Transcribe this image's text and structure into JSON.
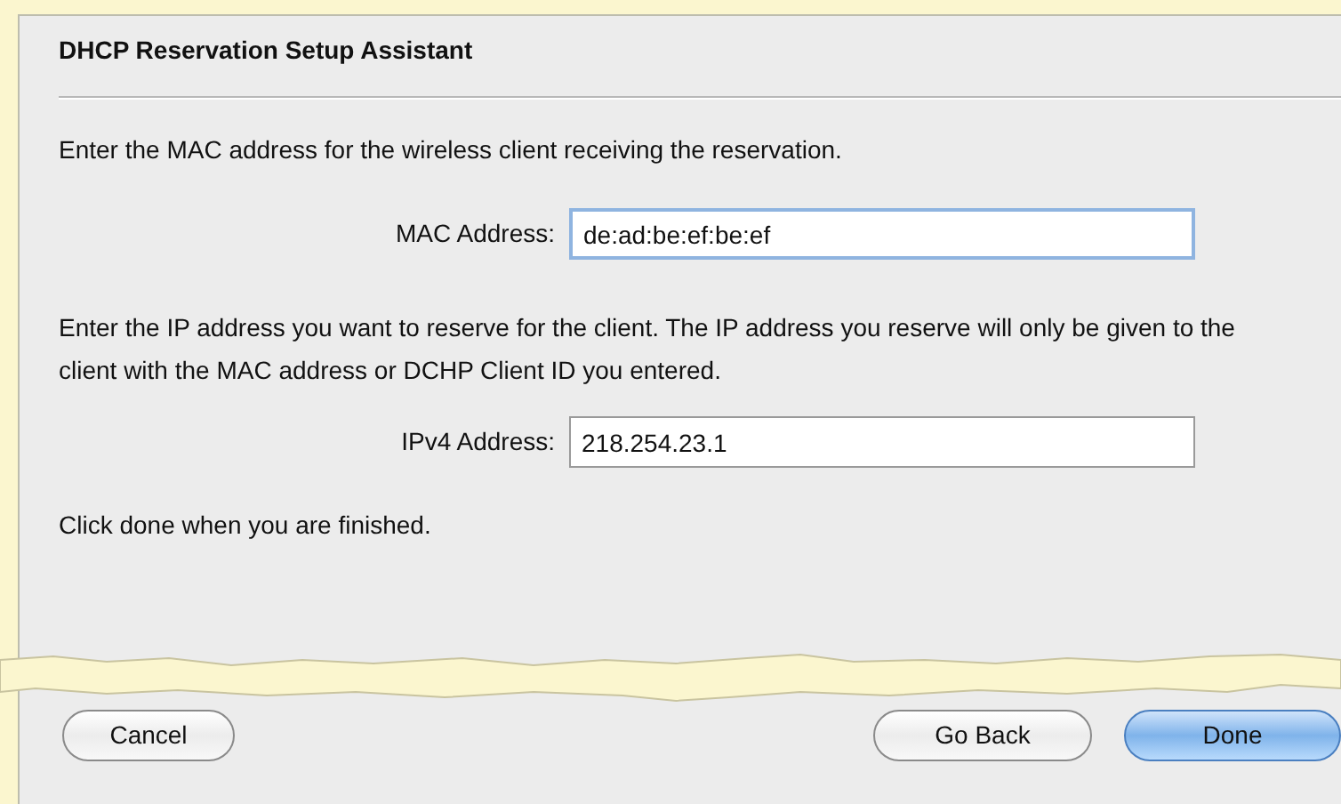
{
  "sheet": {
    "title": "DHCP Reservation Setup Assistant"
  },
  "mac_prompt": "Enter the MAC address for the wireless client receiving the reservation.",
  "mac_field": {
    "label": "MAC Address:",
    "value": "de:ad:be:ef:be:ef",
    "focused": true
  },
  "ip_prompt": "Enter the IP address you want to reserve for the client. The IP address you reserve will only be given to the client with the MAC address or DCHP Client ID you entered.",
  "ip_field": {
    "label": "IPv4 Address:",
    "value": "218.254.23.1",
    "focused": false
  },
  "finish_note": "Click done when you are finished.",
  "buttons": [
    {
      "label": "Cancel",
      "kind": "cancel",
      "default": false
    },
    {
      "label": "Go Back",
      "kind": "back",
      "default": false
    },
    {
      "label": "Done",
      "kind": "done",
      "default": true
    }
  ]
}
